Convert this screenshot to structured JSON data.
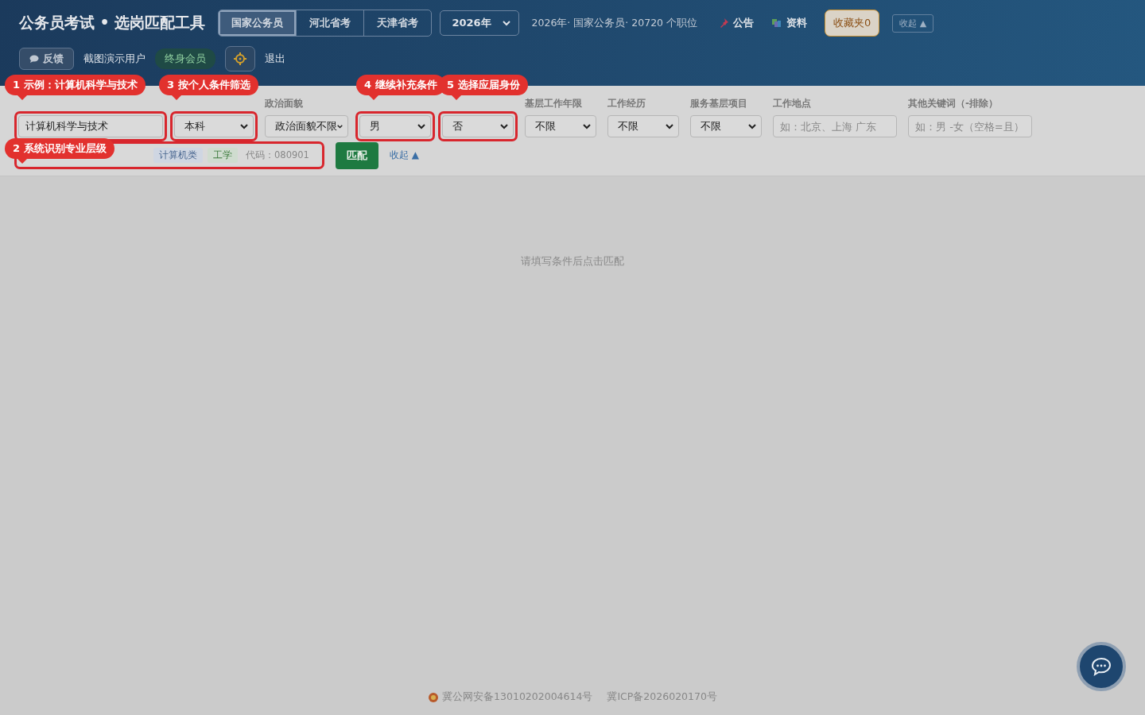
{
  "header": {
    "title": "公务员考试 • 选岗匹配工具",
    "tabs": [
      {
        "label": "国家公务员",
        "selected": true
      },
      {
        "label": "河北省考",
        "selected": false
      },
      {
        "label": "天津省考",
        "selected": false
      }
    ],
    "year": "2026年",
    "summary": "2026年· 国家公务员· 20720 个职位",
    "links": [
      {
        "label": "公告",
        "kind": "notice"
      },
      {
        "label": "资料",
        "kind": "material"
      }
    ],
    "favorites": "收藏夹0",
    "collapse": "收起 ▲"
  },
  "user_bar": {
    "feedback": "反馈",
    "user": "截图演示用户",
    "badge": "终身会员",
    "logout": "退出"
  },
  "filters": [
    {
      "kind": "input",
      "value": "计算机科学与技术",
      "highlighted": true
    },
    {
      "kind": "select",
      "value": "本科",
      "highlighted": true
    },
    {
      "kind": "select",
      "label": "政治面貌",
      "value": "政治面貌不限",
      "highlighted": false
    },
    {
      "kind": "select",
      "value": "男",
      "highlighted": true
    },
    {
      "kind": "select",
      "value": "否",
      "highlighted": true
    },
    {
      "kind": "select",
      "label": "基层工作年限",
      "value": "不限",
      "highlighted": false
    },
    {
      "kind": "select",
      "label": "工作经历",
      "value": "不限",
      "highlighted": false
    },
    {
      "kind": "select",
      "label": "服务基层项目",
      "value": "不限",
      "highlighted": false
    },
    {
      "kind": "input",
      "label": "工作地点",
      "placeholder": "如：北京、上海 广东",
      "highlighted": false
    },
    {
      "kind": "input",
      "label": "其他关键词（-排除）",
      "placeholder": "如：男 -女（空格=且）",
      "highlighted": false
    }
  ],
  "hint": {
    "highlighted": true,
    "chips": [
      {
        "text": "计算机类",
        "kind": "category"
      },
      {
        "text": "工学",
        "kind": "discipline"
      },
      {
        "text": "代码：080901",
        "kind": "code"
      }
    ]
  },
  "actions": {
    "match": "匹配",
    "collapse": "收起 ▲"
  },
  "tour_steps": [
    {
      "number": "1",
      "text": "示例：计算机科学与技术"
    },
    {
      "number": "2",
      "text": "系统识别专业层级"
    },
    {
      "number": "3",
      "text": "按个人条件筛选"
    },
    {
      "number": "4",
      "text": "继续补充条件"
    },
    {
      "number": "5",
      "text": "选择应届身份"
    }
  ],
  "empty": "请填写条件后点击匹配",
  "footer": [
    {
      "text": "冀公网安备13010202004614号",
      "kind": "police"
    },
    {
      "text": "冀ICP备2026020170号",
      "kind": "icp"
    }
  ]
}
